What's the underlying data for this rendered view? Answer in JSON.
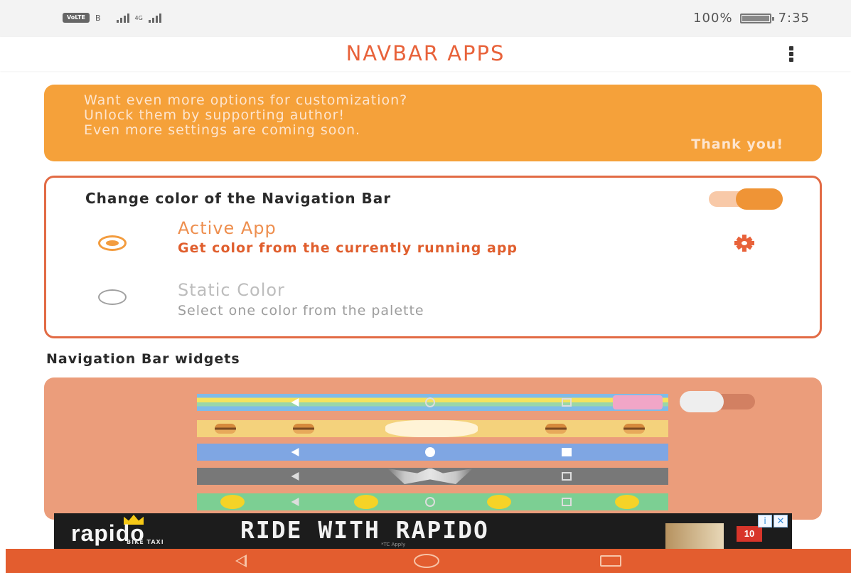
{
  "status_bar": {
    "volte_label": "VoLTE",
    "sim_indicator": "B",
    "network_label": "4G",
    "battery_text": "100%",
    "time": "7:35"
  },
  "app_bar": {
    "title": "NAVBAR APPS",
    "overflow_icon": "more-vert-icon"
  },
  "promo": {
    "lines": [
      "Want even more options for customization?",
      "Unlock them by supporting author!",
      "Even more settings are coming soon."
    ],
    "thanks": "Thank you!"
  },
  "color_card": {
    "title": "Change color of the Navigation Bar",
    "enabled": true,
    "options": [
      {
        "title": "Active App",
        "description": "Get color from the currently running app",
        "selected": true
      },
      {
        "title": "Static Color",
        "description": "Select one color from the palette",
        "selected": false
      }
    ],
    "settings_icon": "gear-icon"
  },
  "widgets_section": {
    "heading": "Navigation Bar widgets",
    "enabled": false,
    "styles": [
      "nyan-cat",
      "cartoon-face",
      "blue-solid",
      "batman",
      "emoji-smileys"
    ]
  },
  "ad": {
    "brand": "rapido",
    "brand_sub": "BIKE TAXI",
    "headline": "RIDE WITH RAPIDO",
    "disclaimer": "*TC Apply",
    "badge": "10",
    "info_icon": "info-icon",
    "close_icon": "close-icon"
  },
  "system_nav": {
    "back_icon": "back-triangle-icon",
    "home_icon": "home-circle-icon",
    "recents_icon": "recents-square-icon"
  },
  "colors": {
    "accent": "#e8623a",
    "promo_bg": "#f5a13a",
    "card_border": "#e26b45",
    "widgets_bg": "#eb9d7b",
    "system_nav_bg": "#e35d2f"
  }
}
